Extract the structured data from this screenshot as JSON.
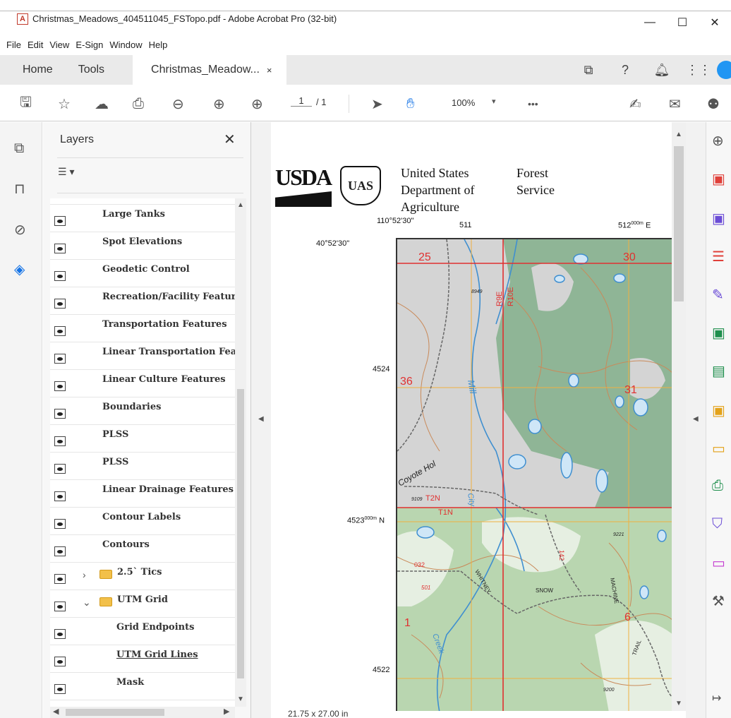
{
  "window": {
    "title": "Christmas_Meadows_404511045_FSTopo.pdf - Adobe Acrobat Pro (32-bit)",
    "controls": {
      "minimize": "—",
      "maximize": "☐",
      "close": "✕"
    }
  },
  "menu": [
    "File",
    "Edit",
    "View",
    "E-Sign",
    "Window",
    "Help"
  ],
  "tabs": {
    "home": "Home",
    "tools": "Tools",
    "doc": "Christmas_Meadow...",
    "doc_close": "×"
  },
  "toolbar": {
    "page_current": "1",
    "page_total": "/ 1",
    "zoom": "100%",
    "more": "•••"
  },
  "layers_panel": {
    "title": "Layers",
    "close": "✕",
    "options_icon": "☰ ▾",
    "items": [
      {
        "label": "Large Tanks"
      },
      {
        "label": "Spot Elevations"
      },
      {
        "label": "Geodetic Control"
      },
      {
        "label": "Recreation/Facility Features"
      },
      {
        "label": "Transportation Features"
      },
      {
        "label": "Linear Transportation Features"
      },
      {
        "label": "Linear Culture Features"
      },
      {
        "label": "Boundaries"
      },
      {
        "label": "PLSS"
      },
      {
        "label": "PLSS"
      },
      {
        "label": "Linear Drainage Features"
      },
      {
        "label": "Contour Labels"
      },
      {
        "label": "Contours"
      },
      {
        "label": "2.5` Tics",
        "folder": true,
        "expanded": false
      },
      {
        "label": "UTM Grid",
        "folder": true,
        "expanded": true
      },
      {
        "label": "Grid Endpoints",
        "child": true
      },
      {
        "label": "UTM Grid Lines",
        "child": true,
        "underline": true
      },
      {
        "label": "Mask",
        "child": true
      }
    ]
  },
  "document": {
    "usda": "USDA",
    "fs_shield": "UAS",
    "agency_line1": "United States",
    "agency_line2": "Department of",
    "agency_line3": "Agriculture",
    "agency_right1": "Forest",
    "agency_right2": "Service",
    "lon_label": "110°52'30\"",
    "easting_511": "511",
    "easting_512": "512",
    "easting_512_sup": "000m",
    "easting_512_e": "E",
    "lat_label": "40°52'30\"",
    "northing_4524": "4524",
    "northing_4523": "4523",
    "northing_4523_sup": "000m",
    "northing_4523_n": "N",
    "northing_4522": "4522",
    "section_labels": [
      "25",
      "30",
      "36",
      "31",
      "1",
      "6"
    ],
    "range_labels": [
      "R9E",
      "R10E"
    ],
    "township_labels": [
      "T2N",
      "T1N"
    ],
    "elevation_labels": [
      "8949",
      "9109",
      "9221",
      "9200"
    ],
    "feature_labels": [
      "Mill",
      "Coyote Hol",
      "Creek",
      "City",
      "WHITNEY",
      "SNOW",
      "MACHINE",
      "TRAIL",
      "032",
      "501",
      "142"
    ],
    "page_size": "21.75 x 27.00 in"
  },
  "colors": {
    "forest": "#8fb596",
    "forest_dark": "#7fa887",
    "cleared": "#d4d4d4",
    "water": "#3f8fd0",
    "contour": "#c98a5a",
    "plss_red": "#e03030",
    "utm_orange": "#f0b040"
  }
}
